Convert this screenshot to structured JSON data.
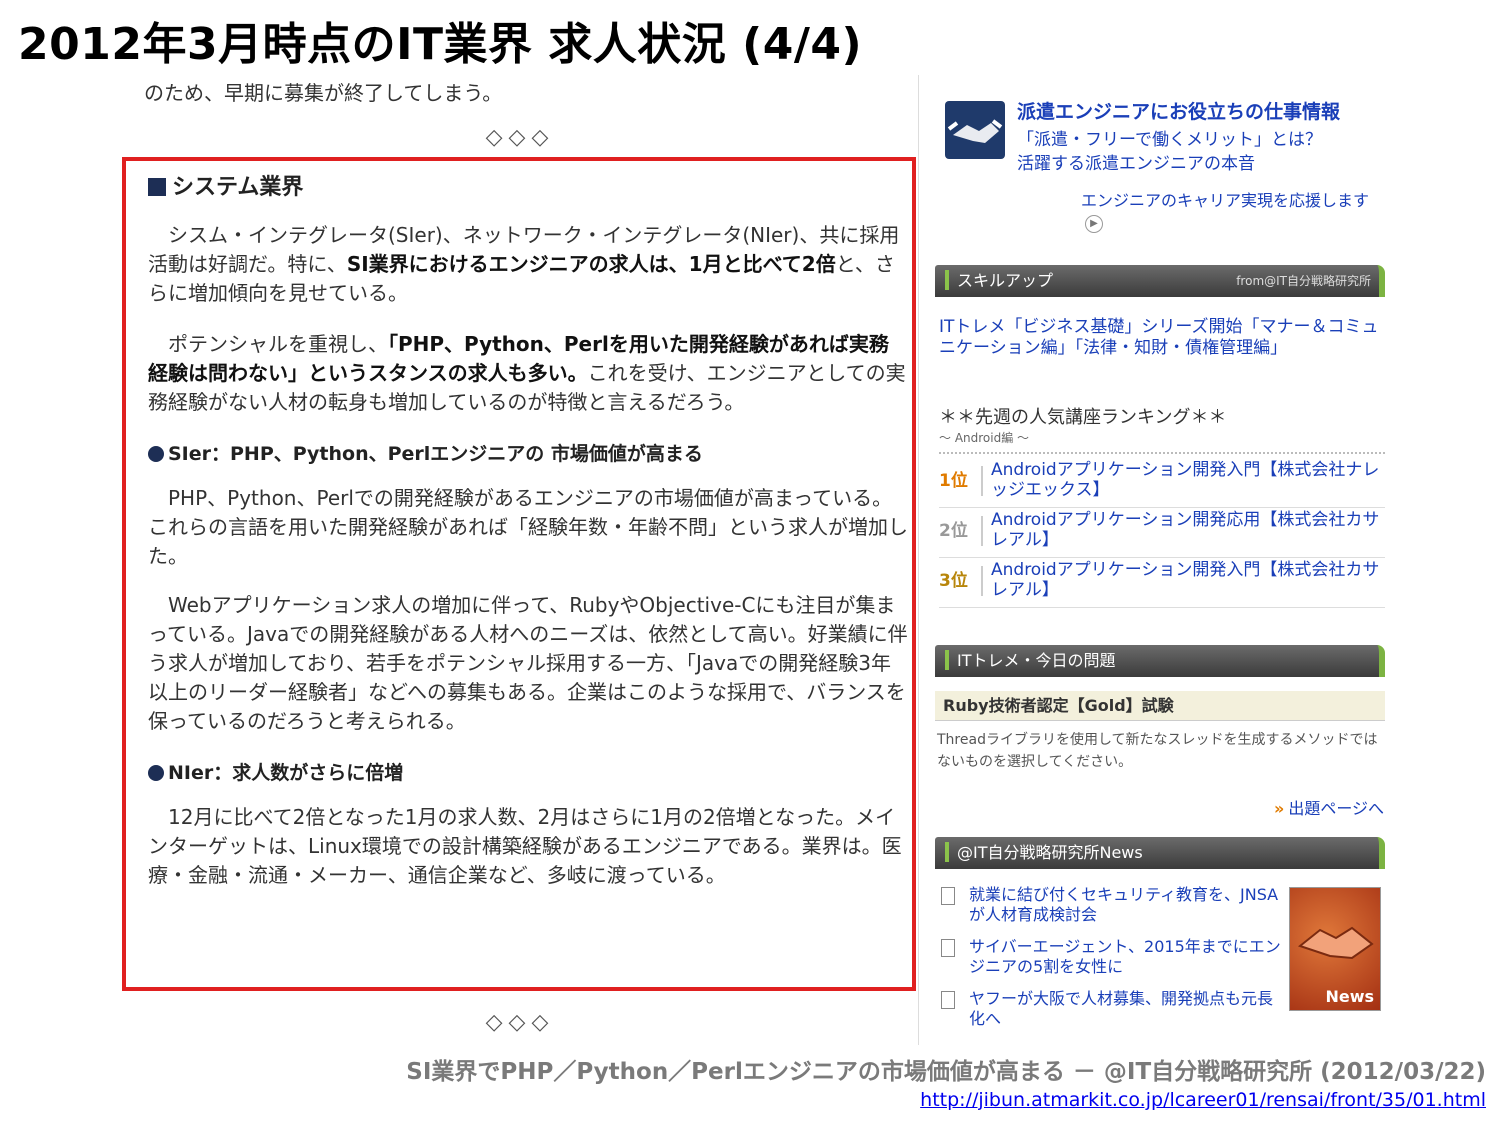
{
  "slide": {
    "title": "2012年3月時点のIT業界 求人状況 (4/4)",
    "caption": "SI業界でPHP／Python／Perlエンジニアの市場価値が高まる － @IT自分戦略研究所 (2012/03/22)",
    "source_url": "http://jibun.atmarkit.co.jp/lcareer01/rensai/front/35/01.html"
  },
  "article": {
    "lead_line": "のため、早期に募集が終了してしまう。",
    "separator": "◇◇◇",
    "section_title": "システム業界",
    "p1_normal_a": "シスム・インテグレータ(SIer)、ネットワーク・インテグレータ(NIer)、共に採用活動は好調だ。特に、",
    "p1_bold": "SI業界におけるエンジニアの求人は、1月と比べて2倍",
    "p1_normal_b": "と、さらに増加傾向を見せている。",
    "p2_normal_a": "ポテンシャルを重視し、",
    "p2_bold": "「PHP、Python、Perlを用いた開発経験があれば実務経験は問わない」というスタンスの求人も多い。",
    "p2_normal_b": "これを受け、エンジニアとしての実務経験がない人材の転身も増加しているのが特徴と言えるだろう。",
    "sub1": "SIer：PHP、Python、Perlエンジニアの 市場価値が高まる",
    "p3": "PHP、Python、Perlでの開発経験があるエンジニアの市場価値が高まっている。これらの言語を用いた開発経験があれば「経験年数・年齢不問」という求人が増加した。",
    "p4": "Webアプリケーション求人の増加に伴って、RubyやObjective-Cにも注目が集まっている。Javaでの開発経験がある人材へのニーズは、依然として高い。好業績に伴う求人が増加しており、若手をポテンシャル採用する一方、「Javaでの開発経験3年以上のリーダー経験者」などへの募集もある。企業はこのような採用で、バランスを保っているのだろうと考えられる。",
    "sub2": "NIer：求人数がさらに倍増",
    "p5": "12月に比べて2倍となった1月の求人数、2月はさらに1月の2倍増となった。メインターゲットは、Linux環境での設計構築経験があるエンジニアである。業界は。医療・金融・流通・メーカー、通信企業など、多岐に渡っている。"
  },
  "sidebar": {
    "promo_title": "派遣エンジニアにお役立ちの仕事情報",
    "promo_line1": "「派遣・フリーで働くメリット」とは？",
    "promo_line2": "活躍する派遣エンジニアの本音",
    "promo_more": "エンジニアのキャリア実現を応援します",
    "skill_bar": "スキルアップ",
    "skill_bar_right": "from@IT自分戦略研究所",
    "skill_link": "ITトレメ「ビジネス基礎」シリーズ開始「マナー＆コミュニケーション編」「法律・知財・債権管理編」",
    "rank_title": "＊＊先週の人気講座ランキング＊＊",
    "rank_sub": "～ Android編 ～",
    "ranks": [
      {
        "pos": "1位",
        "text": "Androidアプリケーション開発入門【株式会社ナレッジエックス】",
        "color": "#e07b00"
      },
      {
        "pos": "2位",
        "text": "Androidアプリケーション開発応用【株式会社カサレアル】",
        "color": "#999999"
      },
      {
        "pos": "3位",
        "text": "Androidアプリケーション開発入門【株式会社カサレアル】",
        "color": "#b8860b"
      }
    ],
    "quiz_bar": "ITトレメ・今日の問題",
    "quiz_question": "Ruby技術者認定【Gold】試験",
    "quiz_text": "Threadライブラリを使用して新たなスレッドを生成するメソッドではないものを選択してください。",
    "quiz_link": "出題ページへ",
    "news_bar": "@IT自分戦略研究所News",
    "news": [
      "就業に結び付くセキュリティ教育を、JNSAが人材育成検討会",
      "サイバーエージェント、2015年までにエンジニアの5割を女性に",
      "ヤフーが大阪で人材募集、開発拠点も元長化へ"
    ],
    "news_image_label": "News"
  }
}
